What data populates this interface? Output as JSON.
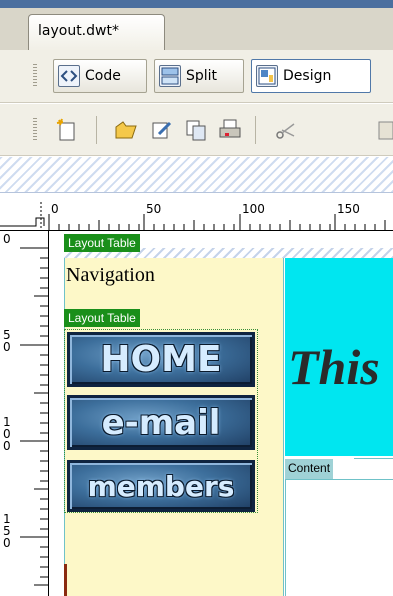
{
  "document_tab": {
    "title": "layout.dwt*"
  },
  "view_buttons": [
    {
      "label": "Code",
      "icon": "code-view-icon"
    },
    {
      "label": "Split",
      "icon": "split-view-icon"
    },
    {
      "label": "Design",
      "icon": "design-view-icon",
      "active": true
    }
  ],
  "toolbar_icons": [
    "new-document-icon",
    "open-folder-icon",
    "edit-icon",
    "copy-icon",
    "print-icon",
    "cut-icon",
    "paste-icon"
  ],
  "rulers": {
    "horizontal": [
      "0",
      "50",
      "100",
      "150"
    ],
    "vertical_marks": [
      {
        "label_digits": [
          "0"
        ]
      },
      {
        "label_digits": [
          "5",
          "0"
        ]
      },
      {
        "label_digits": [
          "1",
          "0",
          "0"
        ]
      },
      {
        "label_digits": [
          "1",
          "5",
          "0"
        ]
      }
    ]
  },
  "design": {
    "layout_table_tag": "Layout Table",
    "navigation_text": "Navigation",
    "inner_layout_table_tag": "Layout Table",
    "nav_buttons": [
      "HOME",
      "e-mail",
      "members"
    ],
    "header_text": "This",
    "content_tag": "Content"
  },
  "colors": {
    "tag_green": "#1a8f1a",
    "nav_cell": "#fdf8c8",
    "header_cell": "#00e6f0",
    "content_tag_bg": "#9fd2d6"
  }
}
